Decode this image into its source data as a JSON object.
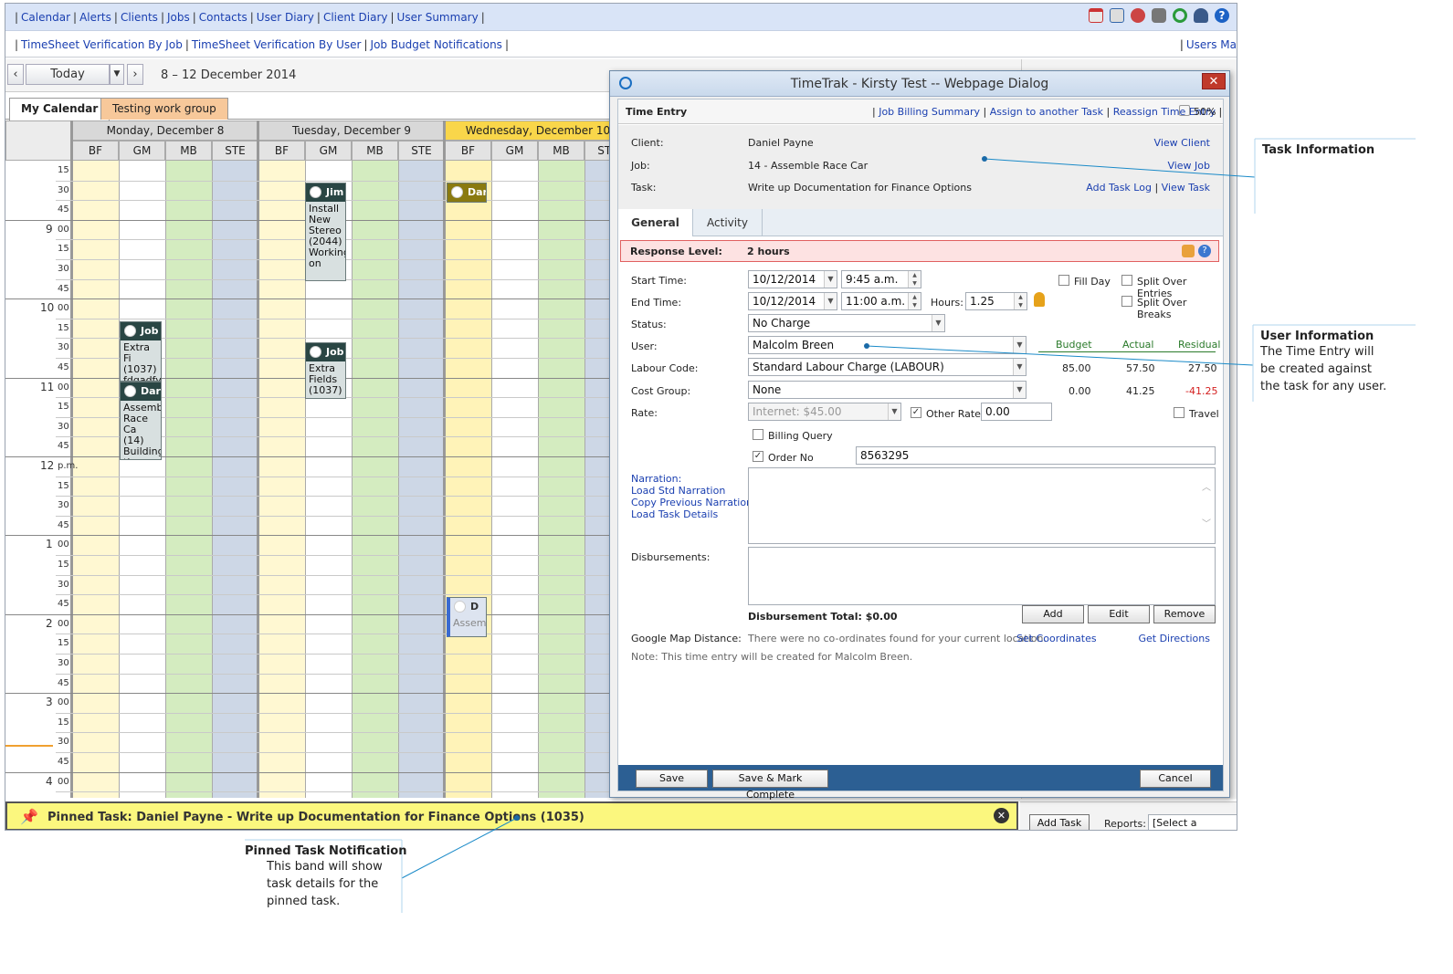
{
  "nav": {
    "primary": [
      "Calendar",
      "Alerts",
      "Clients",
      "Jobs",
      "Contacts",
      "User Diary",
      "Client Diary",
      "User Summary"
    ],
    "secondary": [
      "TimeSheet Verification By Job",
      "TimeSheet Verification By User",
      "Job Budget Notifications"
    ],
    "users_link": "Users Ma"
  },
  "toolbar": {
    "prev": "‹",
    "today": "Today",
    "next": "›",
    "date_range": "8 – 12 December 2014"
  },
  "tabs": {
    "my_calendar": "My Calendar",
    "testing_group": "Testing work group"
  },
  "calendar": {
    "days": [
      "Monday, December 8",
      "Tuesday, December 9",
      "Wednesday, December 10"
    ],
    "sub_cols": [
      "BF",
      "GM",
      "MB",
      "STE"
    ],
    "time_rows": [
      {
        "h": "",
        "m": "15"
      },
      {
        "h": "",
        "m": "30"
      },
      {
        "h": "",
        "m": "45"
      },
      {
        "h": "9",
        "m": "00"
      },
      {
        "h": "",
        "m": "15"
      },
      {
        "h": "",
        "m": "30"
      },
      {
        "h": "",
        "m": "45"
      },
      {
        "h": "10",
        "m": "00"
      },
      {
        "h": "",
        "m": "15"
      },
      {
        "h": "",
        "m": "30"
      },
      {
        "h": "",
        "m": "45"
      },
      {
        "h": "11",
        "m": "00"
      },
      {
        "h": "",
        "m": "15"
      },
      {
        "h": "",
        "m": "30"
      },
      {
        "h": "",
        "m": "45"
      },
      {
        "h": "12",
        "m": "p.m."
      },
      {
        "h": "",
        "m": "15"
      },
      {
        "h": "",
        "m": "30"
      },
      {
        "h": "",
        "m": "45"
      },
      {
        "h": "1",
        "m": "00"
      },
      {
        "h": "",
        "m": "15"
      },
      {
        "h": "",
        "m": "30"
      },
      {
        "h": "",
        "m": "45"
      },
      {
        "h": "2",
        "m": "00"
      },
      {
        "h": "",
        "m": "15"
      },
      {
        "h": "",
        "m": "30"
      },
      {
        "h": "",
        "m": "45"
      },
      {
        "h": "3",
        "m": "00"
      },
      {
        "h": "",
        "m": "15"
      },
      {
        "h": "",
        "m": "30"
      },
      {
        "h": "",
        "m": "45"
      },
      {
        "h": "4",
        "m": "00"
      }
    ],
    "events": {
      "e1": {
        "title": "Jim",
        "body": "Install New Stereo (2044) Working on"
      },
      "e2": {
        "title": "Job",
        "body": "Extra Fi (1037) fdgadfy"
      },
      "e3": {
        "title": "Dar",
        "body": "Assemb Race Ca (14) Building the ass"
      },
      "e4": {
        "title": "Job",
        "body": "Extra Fields (1037)"
      },
      "e5": {
        "title": "Dar",
        "body": ""
      },
      "e6": {
        "title": "D",
        "body": "Assem"
      }
    }
  },
  "pinned": {
    "text": "Pinned Task: Daniel Payne - Write up Documentation for Finance Options (1035)"
  },
  "bottom": {
    "add_task": "Add Task",
    "reports_label": "Reports:",
    "reports_value": "[Select a Report]"
  },
  "dialog": {
    "title": "TimeTrak - Kirsty Test -- Webpage Dialog",
    "close": "✕",
    "header": "Time Entry",
    "header_links": [
      "Job Billing Summary",
      "Assign to another Task",
      "Reassign Time Entry"
    ],
    "percent": "50%",
    "client_label": "Client:",
    "client_value": "Daniel Payne",
    "view_client": "View Client",
    "job_label": "Job:",
    "job_value": "14 - Assemble Race Car",
    "view_job": "View Job",
    "task_label": "Task:",
    "task_value": "Write up Documentation for Finance Options",
    "add_task_log": "Add Task Log",
    "view_task": "View Task",
    "tab_general": "General",
    "tab_activity": "Activity",
    "response_label": "Response Level:",
    "response_value": "2 hours",
    "start_label": "Start Time:",
    "start_date": "10/12/2014",
    "start_time": "9:45 a.m.",
    "end_label": "End Time:",
    "end_date": "10/12/2014",
    "end_time": "11:00 a.m.",
    "hours_label": "Hours:",
    "hours_value": "1.25",
    "fill_day": "Fill Day",
    "split_entries": "Split Over Entries",
    "split_breaks": "Split Over Breaks",
    "status_label": "Status:",
    "status_value": "No Charge",
    "user_label": "User:",
    "user_value": "Malcolm Breen",
    "budget_h": "Budget",
    "actual_h": "Actual",
    "residual_h": "Residual",
    "labour_label": "Labour Code:",
    "labour_value": "Standard Labour Charge (LABOUR)",
    "labour_budget": "85.00",
    "labour_actual": "57.50",
    "labour_residual": "27.50",
    "cost_label": "Cost Group:",
    "cost_value": "None",
    "cost_budget": "0.00",
    "cost_actual": "41.25",
    "cost_residual": "-41.25",
    "rate_label": "Rate:",
    "rate_value": "Internet: $45.00",
    "other_rate": "Other Rate",
    "other_rate_value": "0.00",
    "travel": "Travel",
    "billing_query": "Billing Query",
    "order_no": "Order No",
    "order_no_value": "8563295",
    "narration": "Narration:",
    "load_std": "Load Std Narration",
    "copy_prev": "Copy Previous Narration",
    "load_task": "Load Task Details",
    "disb_label": "Disbursements:",
    "disb_total": "Disbursement Total: $0.00",
    "add": "Add",
    "edit": "Edit",
    "remove": "Remove",
    "gmap_label": "Google Map Distance:",
    "gmap_text": "There were no co-ordinates found for your current location.",
    "set_coords": "Set Coordinates",
    "get_dir": "Get Directions",
    "note": "Note: This time entry will be created for Malcolm Breen.",
    "save": "Save",
    "save_complete": "Save & Mark Complete",
    "cancel": "Cancel"
  },
  "callouts": {
    "task_info": "Task Information",
    "user_info": "User Information",
    "user_info_body": [
      "The Time Entry will",
      "be created against",
      "the task for any user."
    ],
    "pinned_h": "Pinned Task Notification",
    "pinned_body": [
      "This band will show",
      "task details for the",
      "pinned task."
    ]
  },
  "colors": {
    "nav_bg": "#d9e4f7",
    "link": "#1a3fb0",
    "pinned_bg": "#fbf77e",
    "dialog_footer": "#2c5f93",
    "residual_negative": "#d42020",
    "budget_green": "#2a7a2a"
  }
}
